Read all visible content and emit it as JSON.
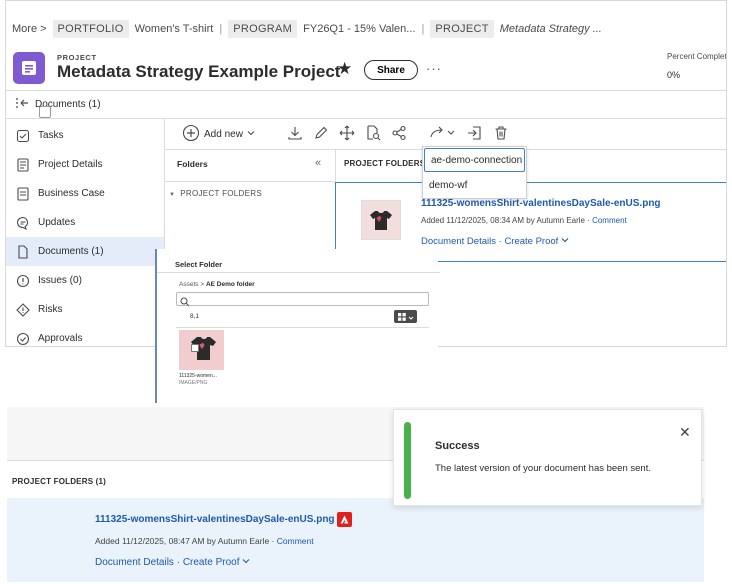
{
  "breadcrumb": {
    "more": "More >",
    "portfolio_tag": "PORTFOLIO",
    "portfolio_name": "Women's T-shirt",
    "program_tag": "PROGRAM",
    "program_name": "FY26Q1 - 15% Valen...",
    "project_tag": "PROJECT",
    "project_name": "Metadata Strategy ..."
  },
  "header": {
    "kicker": "PROJECT",
    "title": "Metadata Strategy Example Project",
    "share_label": "Share",
    "more_label": "···",
    "percent_label": "Percent Complete",
    "percent_value": "0%",
    "icon_color": "#7F5BD2"
  },
  "docbar": {
    "label": "Documents (1)"
  },
  "sidebar": {
    "items": [
      {
        "label": "Tasks",
        "icon": "tasks-icon"
      },
      {
        "label": "Project Details",
        "icon": "details-icon"
      },
      {
        "label": "Business Case",
        "icon": "business-case-icon"
      },
      {
        "label": "Updates",
        "icon": "updates-icon"
      },
      {
        "label": "Documents (1)",
        "icon": "document-icon",
        "active": true
      },
      {
        "label": "Issues (0)",
        "icon": "issues-icon"
      },
      {
        "label": "Risks",
        "icon": "risks-icon"
      },
      {
        "label": "Approvals",
        "icon": "approvals-icon"
      }
    ]
  },
  "toolbar": {
    "add_new": "Add new"
  },
  "folders": {
    "header": "Folders",
    "collapse": "«",
    "tree_root": "PROJECT FOLDERS",
    "list_header": "PROJECT FOLDERS (1"
  },
  "send_menu": {
    "items": [
      "ae-demo-connection",
      "demo-wf"
    ]
  },
  "file": {
    "name": "111325-womensShirt-valentinesDaySale-enUS.png",
    "added": "Added 11/12/2025, 08:34 AM by Autumn Earle",
    "comment": "Comment",
    "details": "Document Details",
    "proof": "Create Proof"
  },
  "select_folder": {
    "title": "Select Folder",
    "crumb_root": "Assets",
    "crumb_sep": ">",
    "crumb_current": "AE Demo folder",
    "count": "8,1",
    "thumb_name": "111325-women...",
    "thumb_type": "IMAGE/PNG"
  },
  "bottom": {
    "header": "PROJECT FOLDERS (1)",
    "file_name": "111325-womensShirt-valentinesDaySale-enUS.png",
    "added": "Added 11/12/2025, 08:47 AM by Autumn Earle",
    "comment": "Comment",
    "details": "Document Details",
    "proof": "Create Proof"
  },
  "toast": {
    "title": "Success",
    "message": "The latest version of your document has been sent.",
    "accent": "#47B04B"
  },
  "colors": {
    "link": "#1D5AB0",
    "selection": "#3F7FD9",
    "adobe_red": "#E0201B"
  }
}
